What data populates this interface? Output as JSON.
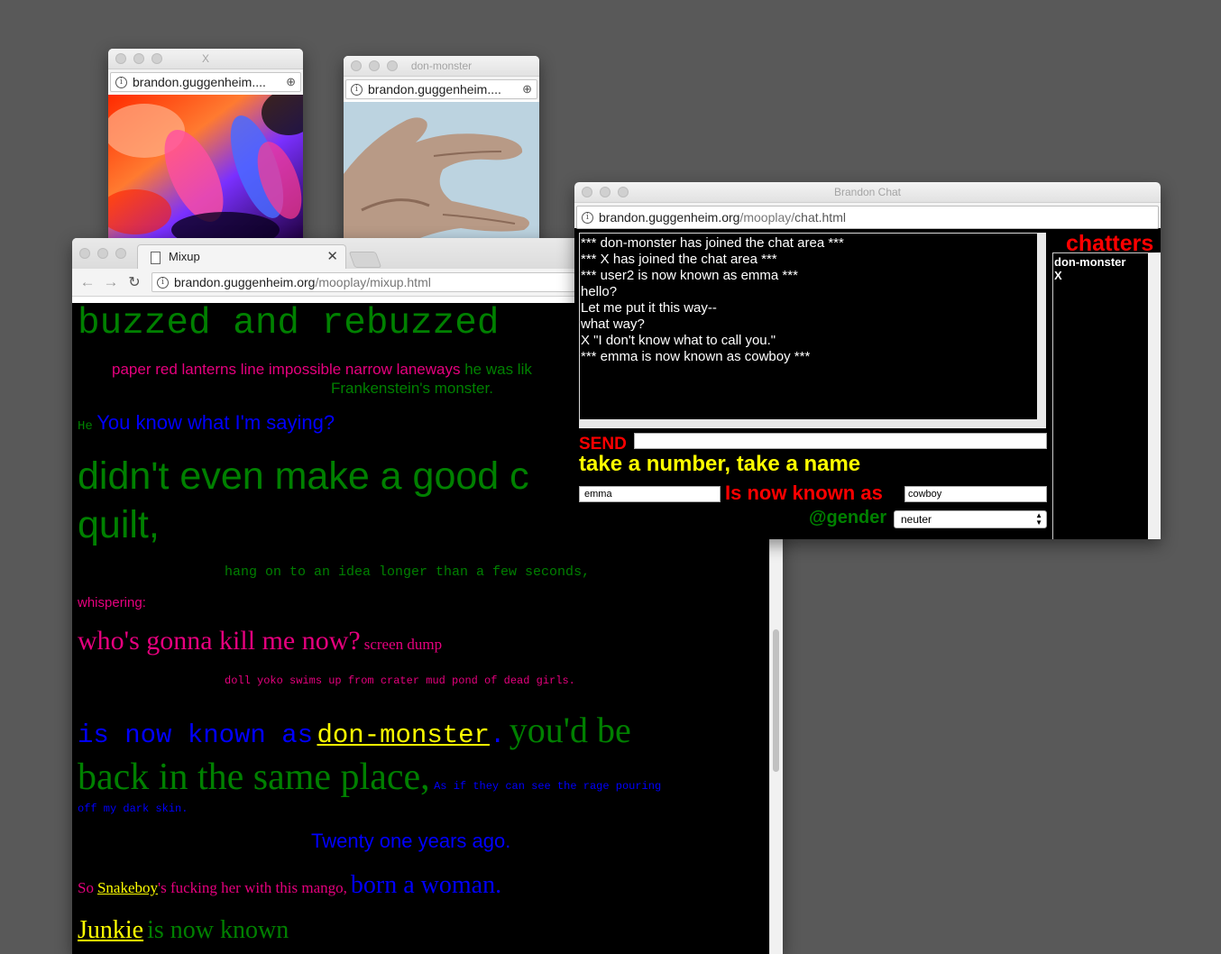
{
  "popup_x": {
    "title": "X",
    "url": "brandon.guggenheim...."
  },
  "popup_don": {
    "title": "don-monster",
    "url": "brandon.guggenheim...."
  },
  "mixup": {
    "tab_title": "Mixup",
    "url_host": "brandon.guggenheim.org",
    "url_path": "/mooplay/mixup.html",
    "lines": {
      "l1": "buzzed and rebuzzed",
      "l2a": "paper red lanterns line impossible narrow laneways",
      "l2b": "he was lik",
      "l2c": "Frankenstein's monster.",
      "l3a": "He",
      "l3b": "You know what I'm saying?",
      "l4a": "didn't even make a good c",
      "l4b": "quilt,",
      "l5": "hang on to an idea longer than a few seconds,",
      "l6": "whispering:",
      "l7a": "who's gonna kill me now?",
      "l7b": "screen dump",
      "l8": "doll yoko swims up from crater mud pond of dead girls.",
      "l9a": "is now known as",
      "l9b": "don-monster",
      "l9c": ".",
      "l9d": "you'd be",
      "l10a": "back in the same place,",
      "l10b": "As if they can see the rage pouring",
      "l11": "off my dark skin.",
      "l12": "Twenty one years ago.",
      "l13a": "So",
      "l13b": "Snakeboy",
      "l13c": "'s fucking her with this mango,",
      "l13d": "born a woman.",
      "l14a": "Junkie",
      "l14b": "is now known"
    }
  },
  "chat": {
    "title": "Brandon Chat",
    "url_host": "brandon.guggenheim.org",
    "url_path_dim": "/mooplay/",
    "url_path_dark": "chat.html",
    "messages": [
      "*** don-monster has joined the chat area ***",
      "*** X has joined the chat area ***",
      "*** user2 is now known as emma ***",
      "hello?",
      "Let me put it this way--",
      "what way?",
      "X \"I don't know what to call you.\"",
      "*** emma is now known as cowboy ***"
    ],
    "send_label": "SEND",
    "send_value": "",
    "take_number": "take a number, take a name",
    "old_name": "emma",
    "known_as": "Is now known as",
    "new_name": "cowboy",
    "gender_label": "@gender",
    "gender_value": "neuter",
    "chatters_title": "chatters",
    "chatters": [
      "don-monster",
      "X"
    ]
  }
}
